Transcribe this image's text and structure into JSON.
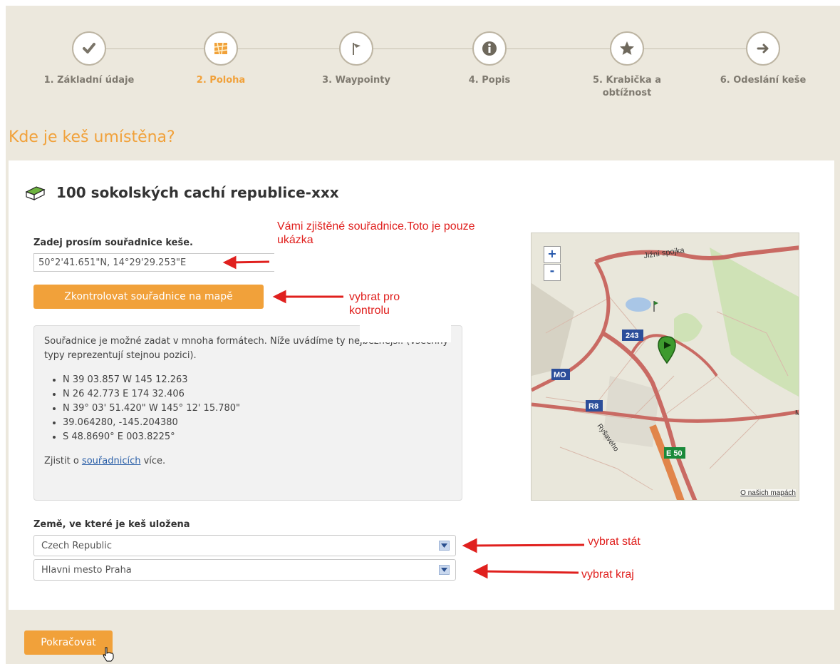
{
  "steps": [
    {
      "label": "1. Základní údaje",
      "icon": "check-icon",
      "active": false
    },
    {
      "label": "2. Poloha",
      "icon": "map-icon",
      "active": true
    },
    {
      "label": "3. Waypointy",
      "icon": "flag-icon",
      "active": false
    },
    {
      "label": "4. Popis",
      "icon": "info-icon",
      "active": false
    },
    {
      "label": "5. Krabička a obtížnost",
      "icon": "star-icon",
      "active": false
    },
    {
      "label": "6. Odeslání keše",
      "icon": "arrow-right-icon",
      "active": false
    }
  ],
  "page": {
    "heading": "Kde je keš umístěna?",
    "cache_title": "100 sokolských cachí republice-xxx"
  },
  "coords": {
    "label": "Zadej prosím souřadnice keše.",
    "value": "50°2'41.651\"N, 14°29'29.253\"E",
    "check_button": "Zkontrolovat souřadnice na mapě"
  },
  "info": {
    "intro": "Souřadnice je možné zadat v mnoha formátech. Níže uvádíme ty nejběžnější: (všechny typy reprezentují stejnou pozici).",
    "formats": [
      "N 39 03.857 W 145 12.263",
      "N 26 42.773 E 174 32.406",
      "N 39° 03' 51.420\" W 145° 12' 15.780\"",
      "39.064280, -145.204380",
      "S 48.8690° E 003.8225°"
    ],
    "more_prefix": "Zjistit o ",
    "more_link": "souřadnicích",
    "more_suffix": " více."
  },
  "map": {
    "zoom_in": "+",
    "zoom_out": "-",
    "labels": {
      "street1": "Jižní spojka",
      "street2": "Ryšavého",
      "road243": "243",
      "mo": "MO",
      "r8": "R8",
      "e50": "E 50",
      "edge": "M"
    },
    "footer_link": "O našich mapách"
  },
  "location": {
    "label": "Země, ve které je keš uložena",
    "country": "Czech Republic",
    "region": "Hlavni mesto Praha"
  },
  "continue_button": "Pokračovat",
  "annotations": {
    "coords_note": "Vámi zjištěné souřadnice.Toto je pouze ukázka",
    "check_note": "vybrat pro kontrolu",
    "country_note": "vybrat stát",
    "region_note": "vybrat kraj"
  },
  "colors": {
    "accent": "#f1a13a",
    "annotation": "#e0201e",
    "background": "#ece8dd"
  }
}
